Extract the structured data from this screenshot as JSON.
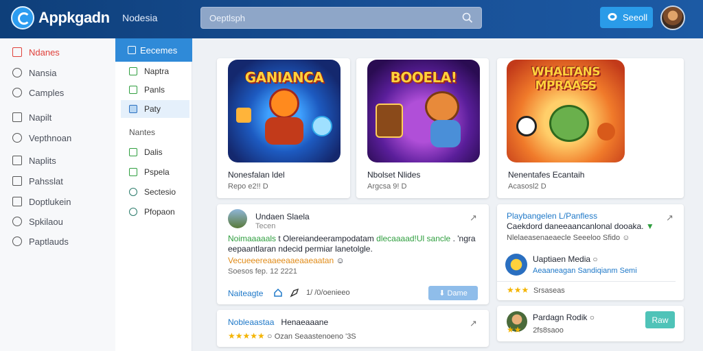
{
  "header": {
    "logo_text": "Appkgadn",
    "nav_label": "Nodesia",
    "search_placeholder": "Oeptlsph",
    "button_label": "Seeoll"
  },
  "sidebar": {
    "items": [
      {
        "label": "Ndanes"
      },
      {
        "label": "Nansia"
      },
      {
        "label": "Camples"
      },
      {
        "label": "Napilt"
      },
      {
        "label": "Vepthnoan"
      },
      {
        "label": "Naplits"
      },
      {
        "label": "Pahsslat"
      },
      {
        "label": "Doptlukein"
      },
      {
        "label": "Spkilaou"
      },
      {
        "label": "Paptlauds"
      }
    ]
  },
  "subnav": {
    "header": "Eecemes",
    "items": [
      {
        "label": "Naptra"
      },
      {
        "label": "Panls"
      },
      {
        "label": "Paty"
      }
    ],
    "section_label": "Nantes",
    "section_items": [
      {
        "label": "Dalis"
      },
      {
        "label": "Pspela"
      },
      {
        "label": "Sectesio"
      },
      {
        "label": "Pfopaon"
      }
    ]
  },
  "games": [
    {
      "art_title": "GANIANCA",
      "name": "Nonesfalan ldel",
      "meta": "Repo e2!! D",
      "colors": [
        "#1a3a8a",
        "#3fa1ff",
        "#ff8a1e"
      ]
    },
    {
      "art_title": "BOOELA!",
      "name": "Nbolset Nlides",
      "meta": "Argcsa 9! D",
      "colors": [
        "#3a1266",
        "#b04fd8",
        "#ff9a2e"
      ]
    },
    {
      "art_title": "WHALTANS MPRAASS",
      "name": "Nenentafes Ecantaih",
      "meta": "Acasosl2 D",
      "colors": [
        "#e24a1a",
        "#ffb03a",
        "#6ab04c"
      ]
    }
  ],
  "post": {
    "author": "Undaen Slaela",
    "subtitle": "Tecen",
    "body_green_1": "Noimaaaaals",
    "body_1": "t Olereiandeerampodatam",
    "body_green_2": "dlecaaaad!Ul sancle",
    "body_1b": ". 'ngra",
    "body_2": "eepaantlaran ndecid permiar lanetolgle.",
    "orange_line": "Vecueeereaaeeaaeaaeaatan",
    "date": "Soesos fep. 12 2221",
    "action_label": "Naiteagte",
    "action_count": "1/ /0/oenieeo",
    "button_label": "Dame"
  },
  "post2": {
    "title_blue": "Nobleaastaa",
    "title": "Henaeaaane",
    "rating_text": "Ozan Seaastenoeno '3S"
  },
  "side_card": {
    "title": "Playbangelen L/Panfless",
    "line_2": "Caekdord daneeaancanlonal dooaka.",
    "line_3": "Nlelaeasenaeaecle Seeeloo Sfido",
    "item_name": "Uaptiaen Media",
    "item_link": "Aeaaneagan Sandiqianm Semi",
    "rating_count": "Srsaseas"
  },
  "side_card2": {
    "name": "Pardagn Rodik",
    "rating_count": "2fs8saoo",
    "button_label": "Raw"
  },
  "colors": {
    "accent": "#2a9be8",
    "header_bg": "#184f95",
    "active_red": "#e0403a",
    "green": "#2e9e3e"
  }
}
